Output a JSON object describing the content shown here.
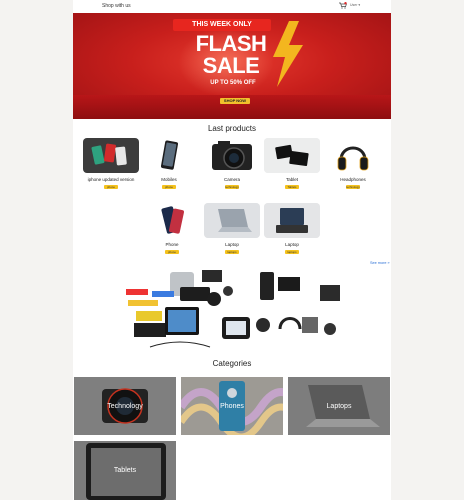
{
  "header": {
    "brand": "Shop with us",
    "user_label": "User ▾"
  },
  "banner": {
    "headline": "THIS WEEK ONLY",
    "flash": "FLASH",
    "sale": "SALE",
    "discount": "UP TO 50% OFF",
    "cta": "SHOP NOW"
  },
  "last_products": {
    "title": "Last products",
    "items": [
      {
        "name": "iphone updated version",
        "category": "phone"
      },
      {
        "name": "Mobiles",
        "category": "phone"
      },
      {
        "name": "Camera",
        "category": "technology"
      },
      {
        "name": "Tablet",
        "category": "Tablets"
      },
      {
        "name": "Headphones",
        "category": "technology"
      },
      {
        "name": "Phone",
        "category": "phone"
      },
      {
        "name": "Laptop",
        "category": "laptops"
      },
      {
        "name": "Laptop",
        "category": "laptops"
      }
    ],
    "see_more": "See more »"
  },
  "categories": {
    "title": "Categories",
    "items": [
      {
        "label": "Technology"
      },
      {
        "label": "Phones"
      },
      {
        "label": "Laptops"
      },
      {
        "label": "Tablets"
      }
    ]
  },
  "colors": {
    "banner_red": "#c81f1c",
    "accent_yellow": "#f4c21d",
    "link_blue": "#2a6fd6",
    "tile_grey": "#7e7e7e"
  },
  "icons": {
    "cart": "cart-icon",
    "bolt": "lightning-bolt-icon"
  }
}
